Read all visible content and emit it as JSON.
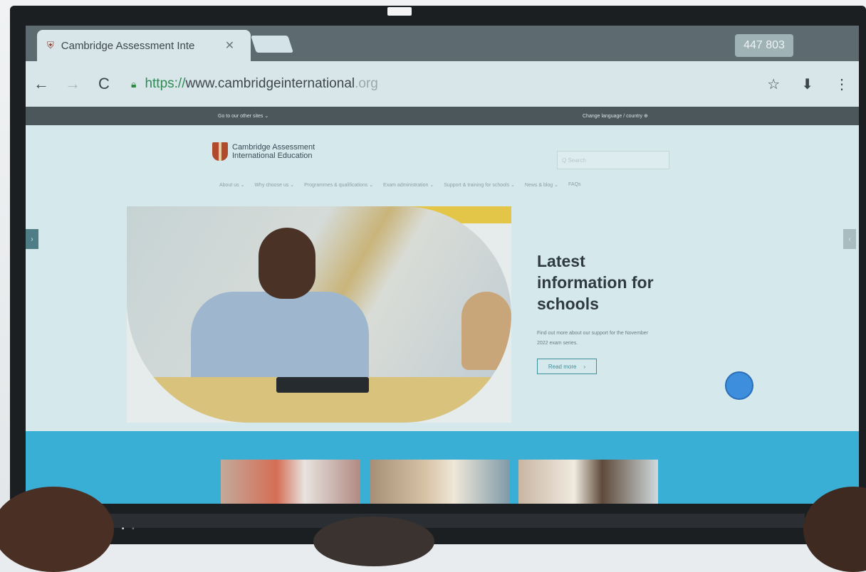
{
  "browser": {
    "tab_title": "Cambridge Assessment Inte",
    "tab_close": "✕",
    "counter": "447 803",
    "url_scheme": "https://",
    "url_host": "www.cambridgeinternational",
    "url_tld": ".org",
    "back_icon": "←",
    "forward_icon": "→",
    "reload_icon": "C",
    "star_icon": "☆",
    "download_icon": "⬇",
    "menu_icon": "⋮"
  },
  "site": {
    "util_left": "Go to our other sites ⌄",
    "util_right": "Change language / country ⊕",
    "logo_line1": "Cambridge Assessment",
    "logo_line2": "International Education",
    "search_placeholder": "Q  Search",
    "nav": [
      "About us ⌄",
      "Why choose us ⌄",
      "Programmes & qualifications ⌄",
      "Exam administration ⌄",
      "Support & training for schools ⌄",
      "News & blog ⌄",
      "FAQs"
    ],
    "hero_title": "Latest information for schools",
    "hero_desc": "Find out more about our support for the November 2022 exam series.",
    "read_more": "Read more",
    "read_more_arrow": "›",
    "arrow_left": "›",
    "arrow_right": "‹"
  },
  "device": {
    "bottom_icons": "■ ▪ ◦"
  }
}
